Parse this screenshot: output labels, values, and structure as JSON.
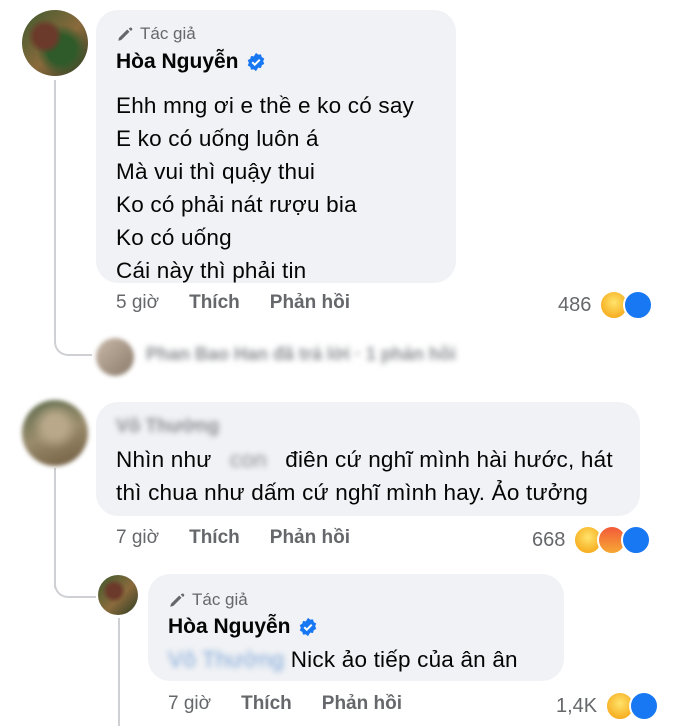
{
  "comments": [
    {
      "author_tag": "Tác giả",
      "name": "Hòa Nguyễn",
      "lines": [
        "Ehh mng ơi e thề e ko có say",
        "E ko có uống luôn á",
        "Mà vui thì quậy thui",
        "Ko có phải nát rượu bia",
        "Ko có uống",
        "Cái này thì phải tin"
      ],
      "time": "5 giờ",
      "like": "Thích",
      "reply": "Phản hồi",
      "count": "486"
    },
    {
      "hidden_reply_preview": "Phan Bao Han đã trả lời · 1 phản hồi",
      "name_blurred": "Vô Thường",
      "line1_before": "Nhìn như",
      "line1_blur": "con",
      "line1_after": "điên cứ nghĩ mình hài hước, hát",
      "line2": "thì chua như dấm cứ nghĩ mình hay. Ảo tưởng",
      "time": "7 giờ",
      "like": "Thích",
      "reply": "Phản hồi",
      "count": "668"
    },
    {
      "author_tag": "Tác giả",
      "name": "Hòa Nguyễn",
      "mention_blurred": "Vô Thường",
      "text": "Nick ảo tiếp của ân ân",
      "time": "7 giờ",
      "like": "Thích",
      "reply": "Phản hồi",
      "count": "1,4K"
    }
  ],
  "colors": {
    "bubble": "#f0f2f5",
    "meta": "#65676b",
    "verified": "#1877f2"
  },
  "icons": [
    "pen-icon",
    "verified-badge-icon",
    "haha-reaction-icon",
    "angry-reaction-icon",
    "like-reaction-icon"
  ]
}
